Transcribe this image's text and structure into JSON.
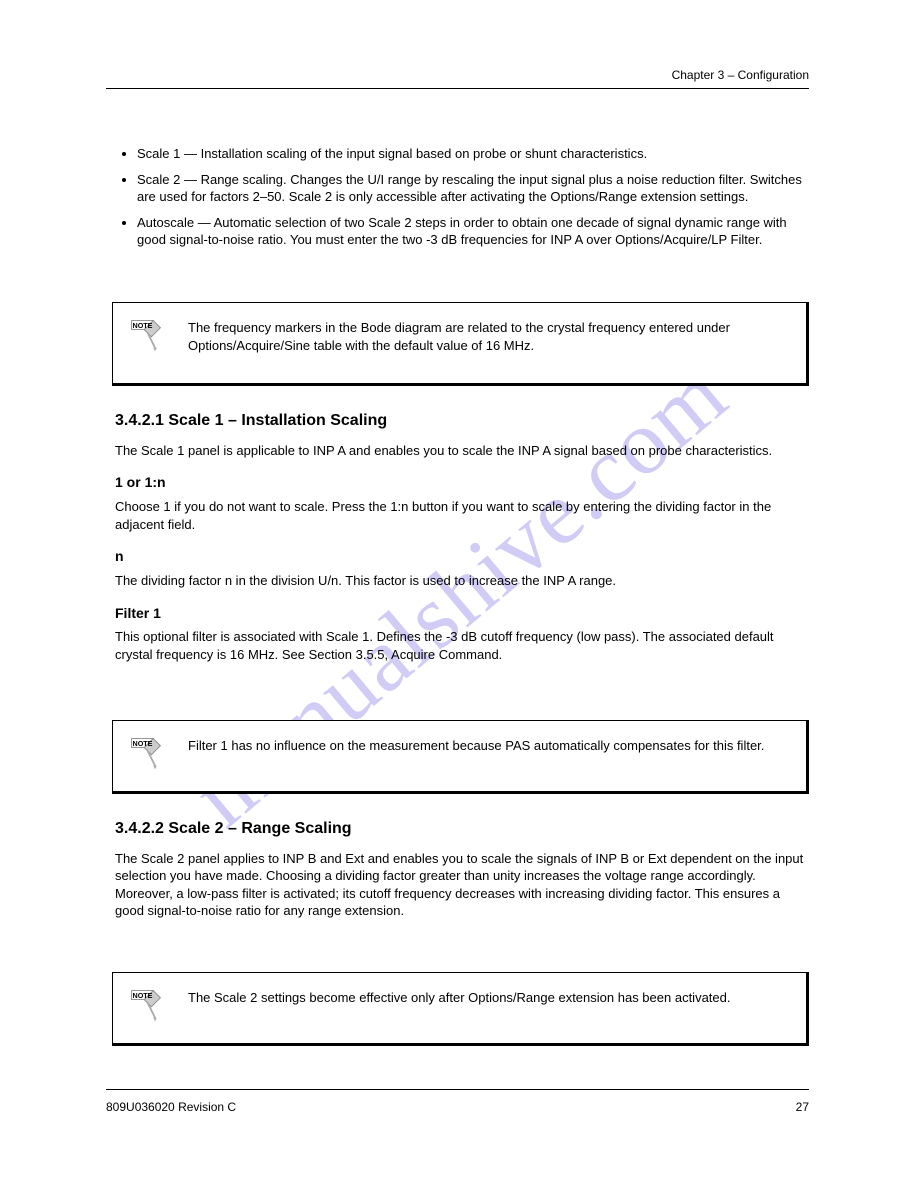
{
  "header": {
    "right": "Chapter 3 – Configuration"
  },
  "footer": {
    "left": "809U036020 Revision C",
    "right": "27"
  },
  "watermark": "manualshive.com",
  "section1": {
    "p1": "Scale 1 — Installation scaling of the input signal based on probe or shunt characteristics.",
    "p2": "Scale 2 — Range scaling. Changes the U/I range by rescaling the input signal plus a noise reduction filter. Switches are used for factors 2–50. Scale 2 is only accessible after activating the Options/Range extension settings.",
    "p3": "Autoscale — Automatic selection of two Scale 2 steps in order to obtain one decade of signal dynamic range with good signal-to-noise ratio. You must enter the two -3 dB frequencies for INP A over Options/Acquire/LP Filter."
  },
  "note1": "The frequency markers in the Bode diagram are related to the crystal frequency entered under Options/Acquire/Sine table with the default value of 16 MHz.",
  "section2": {
    "h3": "3.4.2.1 Scale 1 – Installation Scaling",
    "p1": "The Scale 1 panel is applicable to INP A and enables you to scale the INP A signal based on probe characteristics.",
    "h4a": "1 or 1:n",
    "p2": "Choose 1 if you do not want to scale. Press the 1:n button if you want to scale by entering the dividing factor in the adjacent field.",
    "h4b": "n",
    "p3": "The dividing factor n in the division U/n. This factor is used to increase the INP A range.",
    "h4c": "Filter 1",
    "p4": "This optional filter is associated with Scale 1. Defines the -3 dB cutoff frequency (low pass). The associated default crystal frequency is 16 MHz. See Section 3.5.5, Acquire Command."
  },
  "note2": "Filter 1 has no influence on the measurement because PAS automatically compensates for this filter.",
  "section3": {
    "h3": "3.4.2.2 Scale 2 – Range Scaling",
    "p1": "The Scale 2 panel applies to INP B and Ext and enables you to scale the signals of INP B or Ext dependent on the input selection you have made. Choosing a dividing factor greater than unity increases the voltage range accordingly. Moreover, a low-pass filter is activated; its cutoff frequency decreases with increasing dividing factor. This ensures a good signal-to-noise ratio for any range extension."
  },
  "note3": "The Scale 2 settings become effective only after Options/Range extension has been activated.",
  "note_icon_label": "NOTE"
}
